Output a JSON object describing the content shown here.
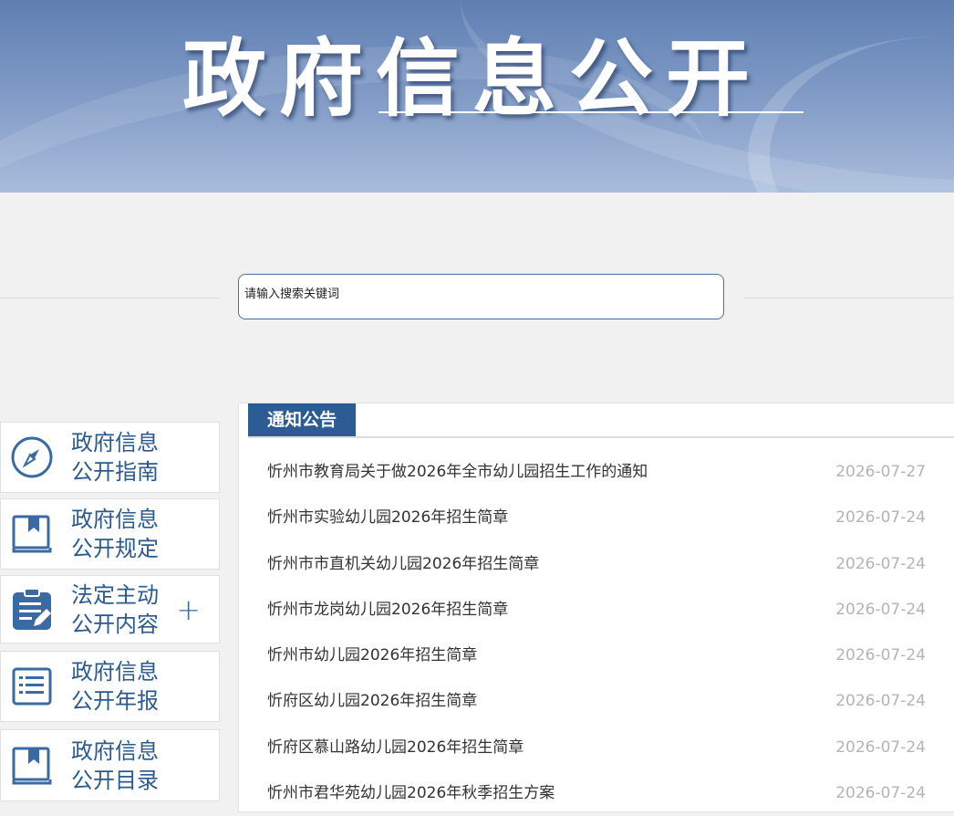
{
  "banner": {
    "title": "政府信息公开"
  },
  "search": {
    "placeholder": "请输入搜索关键词"
  },
  "nav": [
    {
      "line1": "政府信息",
      "line2": "公开指南",
      "icon": "compass-icon"
    },
    {
      "line1": "政府信息",
      "line2": "公开规定",
      "icon": "book-icon"
    },
    {
      "line1": "法定主动",
      "line2": "公开内容",
      "icon": "clipboard-edit-icon",
      "expand": "+"
    },
    {
      "line1": "政府信息",
      "line2": "公开年报",
      "icon": "list-document-icon"
    },
    {
      "line1": "政府信息",
      "line2": "公开目录",
      "icon": "book-icon"
    }
  ],
  "notices": {
    "tab_label": "通知公告",
    "items": [
      {
        "title": "忻州市教育局关于做2026年全市幼儿园招生工作的通知",
        "date": "2026-07-27"
      },
      {
        "title": "忻州市实验幼儿园2026年招生简章",
        "date": "2026-07-24"
      },
      {
        "title": "忻州市市直机关幼儿园2026年招生简章",
        "date": "2026-07-24"
      },
      {
        "title": "忻州市龙岗幼儿园2026年招生简章",
        "date": "2026-07-24"
      },
      {
        "title": "忻州市幼儿园2026年招生简章",
        "date": "2026-07-24"
      },
      {
        "title": "忻府区幼儿园2026年招生简章",
        "date": "2026-07-24"
      },
      {
        "title": "忻府区慕山路幼儿园2026年招生简章",
        "date": "2026-07-24"
      },
      {
        "title": "忻州市君华苑幼儿园2026年秋季招生方案",
        "date": "2026-07-24"
      }
    ]
  },
  "colors": {
    "primary": "#2d5b93",
    "date": "#b4b4b4"
  }
}
